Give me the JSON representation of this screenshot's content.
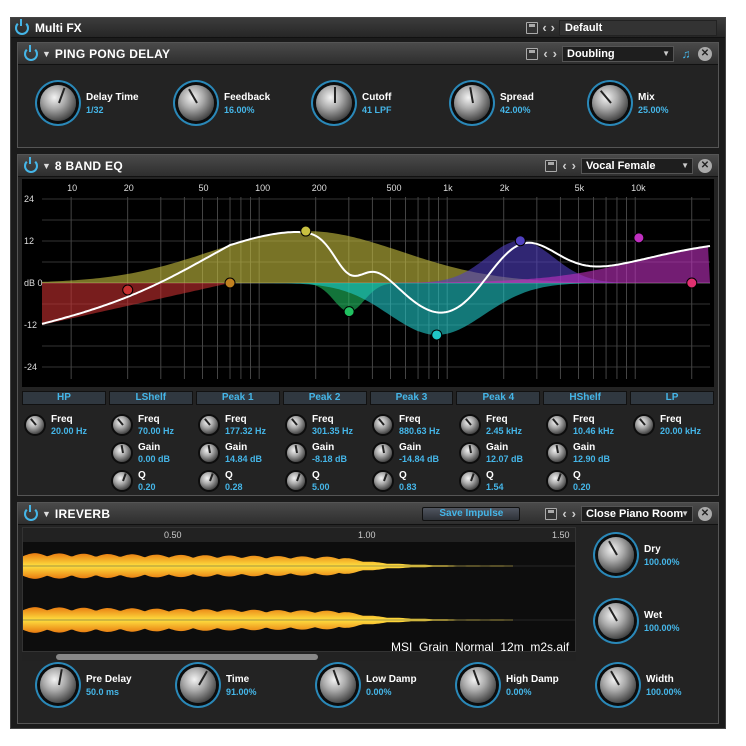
{
  "app": {
    "title": "Multi FX",
    "preset": "Default"
  },
  "colors": {
    "accent": "#45b6e8",
    "eq_hp": "#c83030",
    "eq_lshelf": "#c08020",
    "eq_peak1": "#c8c040",
    "eq_peak2": "#20c060",
    "eq_peak3": "#20c8c8",
    "eq_peak4": "#5040c0",
    "eq_hshelf": "#c030c0",
    "eq_lp": "#e03070"
  },
  "ping_pong": {
    "title": "PING PONG DELAY",
    "preset": "Doubling",
    "knobs": [
      {
        "label": "Delay Time",
        "value": "1/32"
      },
      {
        "label": "Feedback",
        "value": "16.00%"
      },
      {
        "label": "Cutoff",
        "value": "41 LPF"
      },
      {
        "label": "Spread",
        "value": "42.00%"
      },
      {
        "label": "Mix",
        "value": "25.00%"
      }
    ]
  },
  "eq": {
    "title": "8 BAND EQ",
    "preset": "Vocal Female",
    "freq_ticks": [
      "10",
      "20",
      "50",
      "100",
      "200",
      "500",
      "1k",
      "2k",
      "5k",
      "10k"
    ],
    "db_ticks": [
      "24",
      "12",
      "dB 0",
      "-12",
      "-24"
    ],
    "bands": [
      {
        "tab": "HP",
        "params": [
          {
            "label": "Freq",
            "value": "20.00 Hz"
          }
        ]
      },
      {
        "tab": "LShelf",
        "params": [
          {
            "label": "Freq",
            "value": "70.00 Hz"
          },
          {
            "label": "Gain",
            "value": "0.00 dB"
          },
          {
            "label": "Q",
            "value": "0.20"
          }
        ]
      },
      {
        "tab": "Peak 1",
        "params": [
          {
            "label": "Freq",
            "value": "177.32 Hz"
          },
          {
            "label": "Gain",
            "value": "14.84 dB"
          },
          {
            "label": "Q",
            "value": "0.28"
          }
        ]
      },
      {
        "tab": "Peak 2",
        "params": [
          {
            "label": "Freq",
            "value": "301.35 Hz"
          },
          {
            "label": "Gain",
            "value": "-8.18 dB"
          },
          {
            "label": "Q",
            "value": "5.00"
          }
        ]
      },
      {
        "tab": "Peak 3",
        "params": [
          {
            "label": "Freq",
            "value": "880.63 Hz"
          },
          {
            "label": "Gain",
            "value": "-14.84 dB"
          },
          {
            "label": "Q",
            "value": "0.83"
          }
        ]
      },
      {
        "tab": "Peak 4",
        "params": [
          {
            "label": "Freq",
            "value": "2.45 kHz"
          },
          {
            "label": "Gain",
            "value": "12.07 dB"
          },
          {
            "label": "Q",
            "value": "1.54"
          }
        ]
      },
      {
        "tab": "HShelf",
        "params": [
          {
            "label": "Freq",
            "value": "10.46 kHz"
          },
          {
            "label": "Gain",
            "value": "12.90 dB"
          },
          {
            "label": "Q",
            "value": "0.20"
          }
        ]
      },
      {
        "tab": "LP",
        "params": [
          {
            "label": "Freq",
            "value": "20.00 kHz"
          }
        ]
      }
    ]
  },
  "reverb": {
    "title": "IREVERB",
    "save_impulse": "Save Impulse",
    "preset": "Close Piano Room",
    "time_ticks": [
      "0.50",
      "1.00",
      "1.50"
    ],
    "file_name": "MSI_Grain_Normal_12m_m2s.aif",
    "side_knobs": [
      {
        "label": "Dry",
        "value": "100.00%"
      },
      {
        "label": "Wet",
        "value": "100.00%"
      }
    ],
    "knobs": [
      {
        "label": "Pre Delay",
        "value": "50.0 ms"
      },
      {
        "label": "Time",
        "value": "91.00%"
      },
      {
        "label": "Low Damp",
        "value": "0.00%"
      },
      {
        "label": "High Damp",
        "value": "0.00%"
      },
      {
        "label": "Width",
        "value": "100.00%"
      }
    ]
  }
}
